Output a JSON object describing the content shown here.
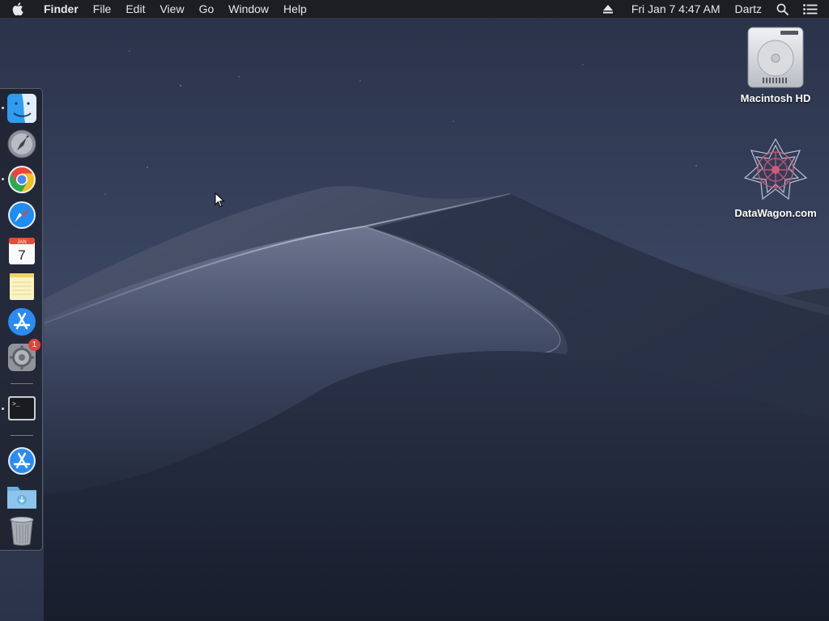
{
  "menubar": {
    "app_name": "Finder",
    "menus": [
      "File",
      "Edit",
      "View",
      "Go",
      "Window",
      "Help"
    ],
    "date_time": "Fri Jan 7  4:47 AM",
    "user": "Dartz",
    "icons": [
      "apple-logo-icon",
      "eject-icon",
      "spotlight-search-icon",
      "notification-center-icon"
    ]
  },
  "desktop": {
    "icons": [
      {
        "label": "Macintosh HD",
        "icon": "hard-drive-icon"
      },
      {
        "label": "DataWagon.com",
        "icon": "datawagon-logo-icon"
      }
    ]
  },
  "dock": {
    "apps": [
      {
        "name": "Finder",
        "icon": "finder-icon",
        "running": true
      },
      {
        "name": "Launchpad",
        "icon": "launchpad-icon",
        "running": false
      },
      {
        "name": "Google Chrome",
        "icon": "chrome-icon",
        "running": true
      },
      {
        "name": "Safari",
        "icon": "safari-icon",
        "running": false
      },
      {
        "name": "Calendar",
        "icon": "calendar-icon",
        "running": false,
        "month": "JAN",
        "day": "7"
      },
      {
        "name": "Notes",
        "icon": "notes-icon",
        "running": false
      },
      {
        "name": "App Store",
        "icon": "app-store-icon",
        "running": false
      },
      {
        "name": "System Preferences",
        "icon": "system-preferences-icon",
        "running": false,
        "badge": "1"
      },
      {
        "name": "Terminal",
        "icon": "terminal-icon",
        "running": true,
        "prompt": ">_"
      },
      {
        "name": "App Store",
        "icon": "app-store-icon",
        "running": false
      },
      {
        "name": "Downloads",
        "icon": "downloads-folder-icon",
        "running": false
      },
      {
        "name": "Trash",
        "icon": "trash-icon",
        "running": false
      }
    ]
  },
  "colors": {
    "menubar_bg": "#1c1c20",
    "sky_top": "#2b3550",
    "sky_bottom": "#3e4a66",
    "dune_dark": "#1a2133",
    "dune_light": "#8e96ad"
  }
}
